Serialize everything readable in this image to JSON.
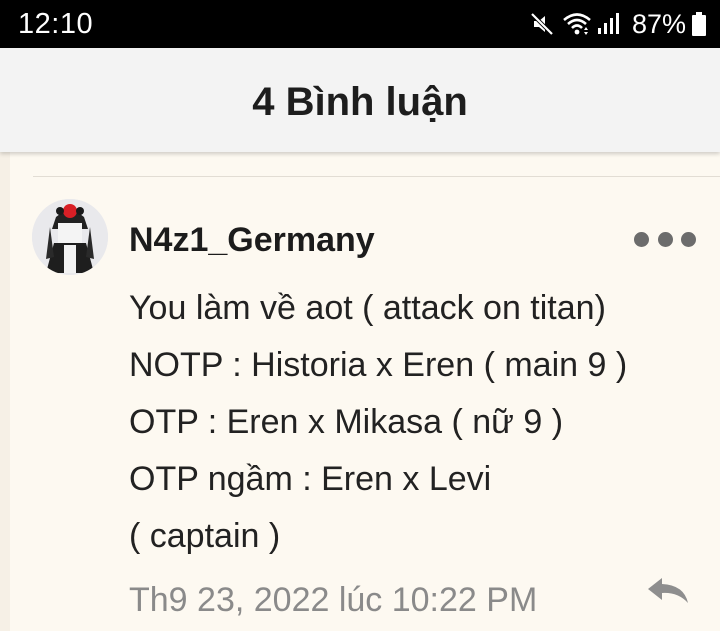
{
  "status_bar": {
    "time": "12:10",
    "battery_percent": "87%",
    "icons": [
      "mute-icon",
      "wifi-icon",
      "signal-icon",
      "battery-icon"
    ]
  },
  "header": {
    "title": "4 Bình luận"
  },
  "comment": {
    "username": "N4z1_Germany",
    "lines": [
      "You làm về aot  ( attack on titan)",
      "NOTP : Historia x Eren ( main 9 )",
      "OTP : Eren x Mikasa ( nữ 9 )",
      "OTP ngầm : Eren x Levi",
      "( captain )"
    ],
    "timestamp": "Th9 23, 2022 lúc 10:22 PM"
  },
  "colors": {
    "status_bar_bg": "#000000",
    "header_bg": "#f3f3f3",
    "panel_bg": "#fdf9f1",
    "muted_text": "#8a8a8a"
  }
}
